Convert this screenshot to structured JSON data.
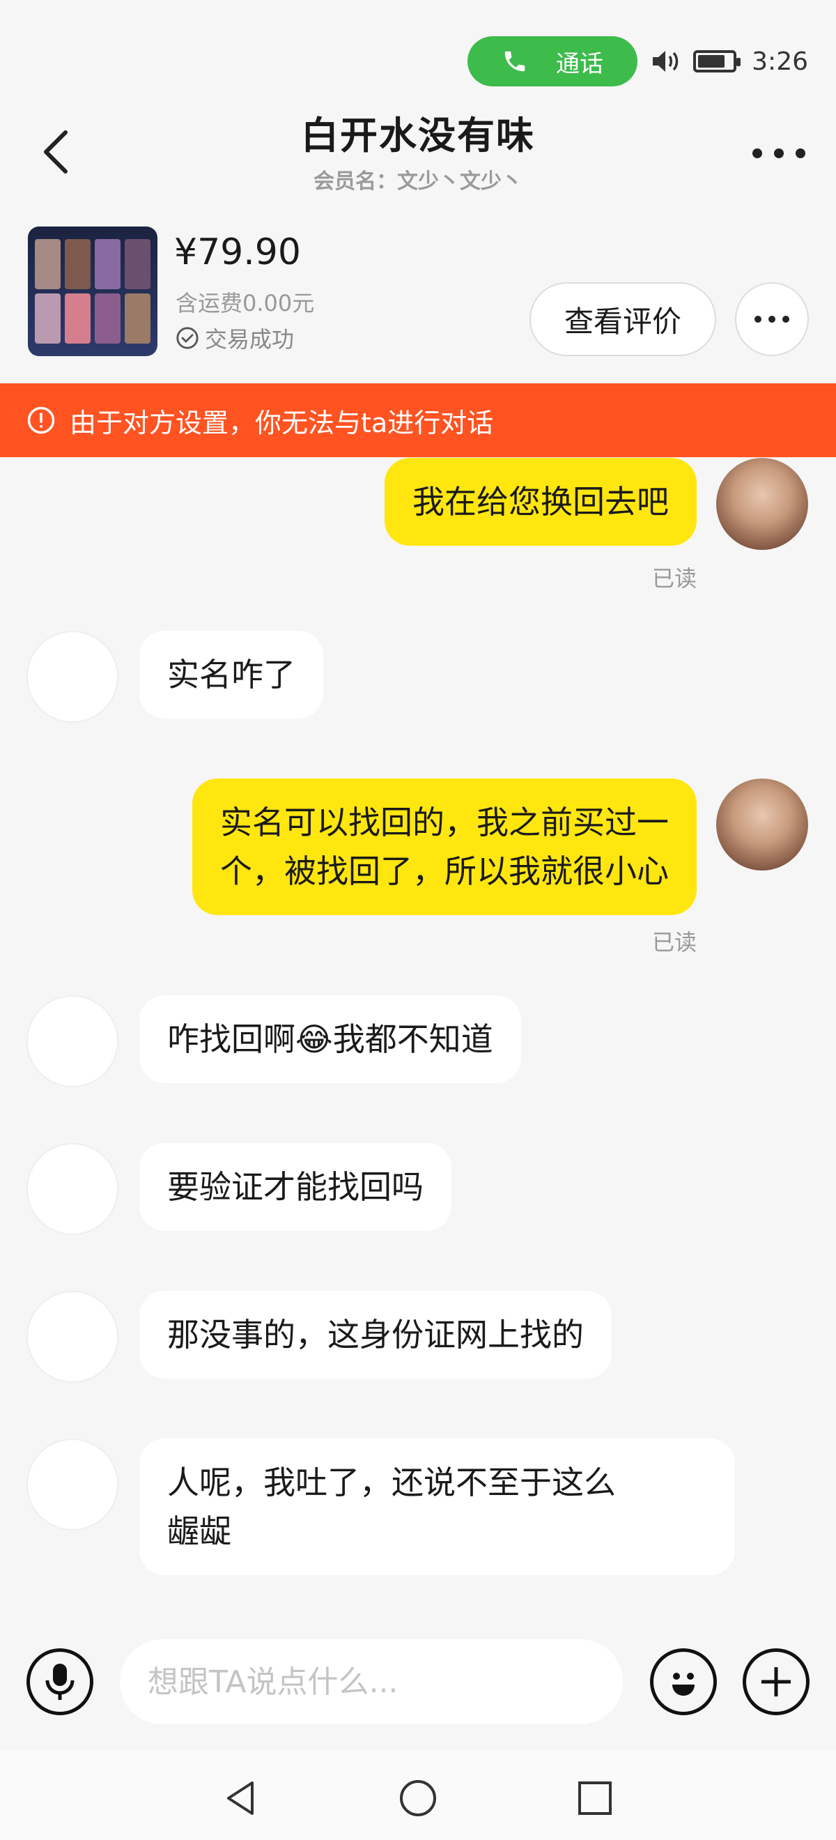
{
  "status_bar": {
    "call_label": "通话",
    "time": "3:26"
  },
  "header": {
    "title": "白开水没有味",
    "member_name": "会员名：文少丶文少丶"
  },
  "product": {
    "price": "¥79.90",
    "shipping": "含运费0.00元",
    "status": "交易成功",
    "review_button": "查看评价"
  },
  "warning": {
    "text": "由于对方设置，你无法与ta进行对话"
  },
  "messages": [
    {
      "from": "me",
      "lines": [
        "我在给您换回去吧"
      ],
      "read": "已读"
    },
    {
      "from": "them",
      "lines": [
        "实名咋了"
      ]
    },
    {
      "from": "me",
      "lines": [
        "实名可以找回的，我之前买过一",
        "个，被找回了，所以我就很小心"
      ],
      "read": "已读"
    },
    {
      "from": "them",
      "pre": "咋找回啊",
      "emoji": "😂",
      "post": "我都不知道"
    },
    {
      "from": "them",
      "lines": [
        "要验证才能找回吗"
      ]
    },
    {
      "from": "them",
      "lines": [
        "那没事的，这身份证网上找的"
      ]
    },
    {
      "from": "them",
      "lines": [
        "人呢，我吐了，还说不至于这么",
        "龌龊"
      ]
    }
  ],
  "input": {
    "placeholder": "想跟TA说点什么..."
  },
  "icons": {
    "call": "phone-icon",
    "back": "chevron-left-icon",
    "more": "more-dots-icon",
    "status_check": "check-circle-icon",
    "warning": "alert-circle-icon",
    "voice": "microphone-icon",
    "emoji": "smiley-icon",
    "add": "plus-icon"
  },
  "colors": {
    "my_bubble": "#ffe60f",
    "their_bubble": "#ffffff",
    "warning_bg": "#ff5322",
    "call_pill": "#3dbb4b"
  }
}
